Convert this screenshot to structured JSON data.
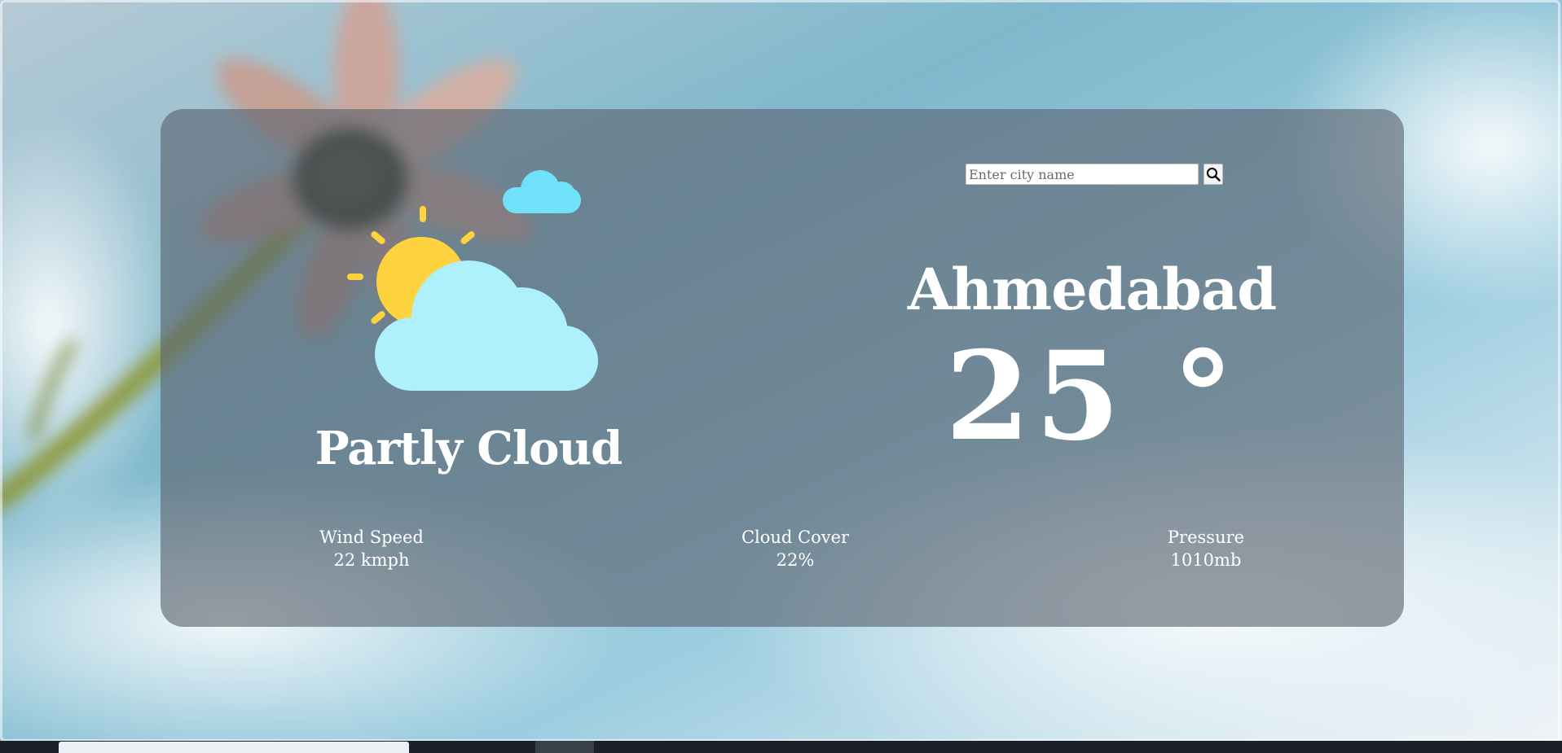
{
  "search": {
    "placeholder": "Enter city name",
    "button_icon": "search-icon"
  },
  "weather": {
    "city": "Ahmedabad",
    "temperature": "25 °",
    "condition": "Partly Cloud",
    "icon": "partly-cloudy-icon"
  },
  "stats": [
    {
      "label": "Wind Speed",
      "value": "22 kmph"
    },
    {
      "label": "Cloud Cover",
      "value": "22%"
    },
    {
      "label": "Pressure",
      "value": "1010mb"
    }
  ],
  "colors": {
    "sun": "#ffd33f",
    "cloud": "#aef0fb",
    "small_cloud": "#6fe1fa",
    "card": "#5a626e",
    "text": "#ffffff"
  }
}
